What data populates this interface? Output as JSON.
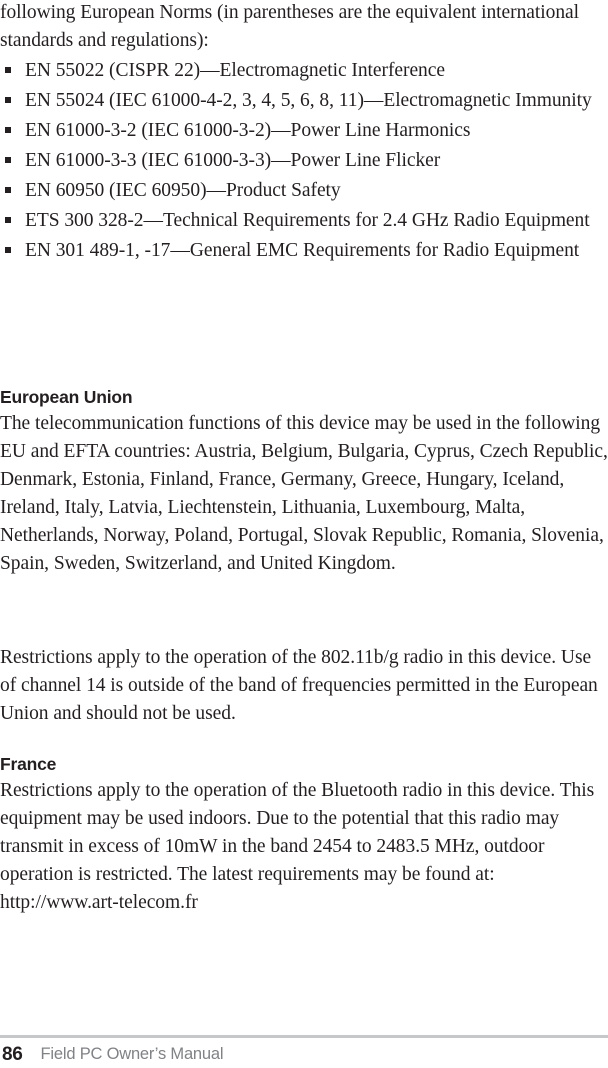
{
  "page": {
    "intro_paragraph": "following European Norms (in parentheses are the equivalent international standards and regulations):",
    "standards_bullets": [
      "EN 55022 (CISPR 22)—Electromagnetic Interference",
      "EN 55024 (IEC 61000-4-2, 3, 4, 5, 6, 8, 11)—Electromagnetic Immunity",
      "EN 61000-3-2 (IEC 61000-3-2)—Power Line Harmonics",
      "EN 61000-3-3 (IEC 61000-3-3)—Power Line Flicker",
      "EN 60950 (IEC 60950)—Product Safety",
      "ETS 300 328-2—Technical Requirements for 2.4 GHz Radio Equipment",
      "EN 301 489-1, -17—General EMC Requirements for Radio Equipment"
    ],
    "sections": [
      {
        "heading": "European Union",
        "paragraphs": [
          "The telecommunication functions of this device may be used in the following EU and EFTA countries: Austria, Belgium, Bulgaria, Cyprus, Czech Republic, Denmark, Estonia, Finland, France, Germany, Greece, Hungary, Iceland, Ireland, Italy, Latvia, Liechtenstein, Lithuania, Luxembourg, Malta, Netherlands, Norway, Poland, Portugal, Slovak Republic, Romania, Slovenia, Spain, Sweden, Switzerland, and United Kingdom.",
          "Restrictions apply to the operation of the 802.11b/g radio in this device. Use of channel 14 is outside of the band of frequencies permitted in the European Union and should not be used."
        ]
      },
      {
        "heading": "France",
        "paragraphs": [
          "Restrictions apply to the operation of the Bluetooth radio in this device. This equipment may be used indoors. Due to the potential that this radio may transmit in excess of 10mW in the band 2454 to 2483.5 MHz, outdoor operation is restricted. The latest requirements may be found at: http://www.art-telecom.fr"
        ]
      }
    ],
    "footer": {
      "page_number": "86",
      "manual_title": "Field PC Owner’s Manual",
      "rule_color": "#c6c7c9",
      "title_color": "#808285"
    },
    "text_color": "#231f20"
  }
}
